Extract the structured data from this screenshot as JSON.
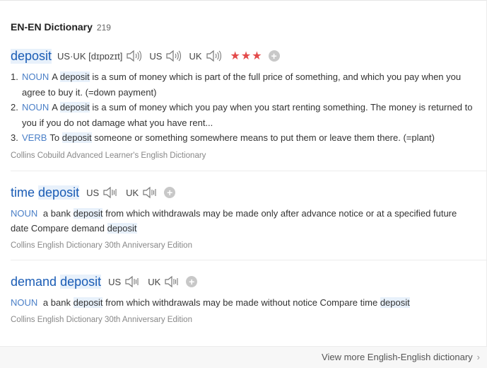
{
  "header": {
    "title": "EN-EN Dictionary",
    "count": "219"
  },
  "entries": [
    {
      "headword": "deposit",
      "pron_label": "US·UK [dɪpɒzɪt]",
      "us_label": "US",
      "uk_label": "UK",
      "stars": "★★★",
      "senses": [
        {
          "num": "1.",
          "pos": "NOUN",
          "pre": "A ",
          "hl": "deposit",
          "post": " is a sum of money which is part of the full price of something, and which you pay when you agree to buy it. (=down payment)"
        },
        {
          "num": "2.",
          "pos": "NOUN",
          "pre": "A ",
          "hl": "deposit",
          "post": " is a sum of money which you pay when you start renting something. The money is returned to you if you do not damage what you have rent..."
        },
        {
          "num": "3.",
          "pos": "VERB",
          "pre": "To ",
          "hl": "deposit",
          "post": " someone or something somewhere means to put them or leave them there. (=plant)"
        }
      ],
      "source": "Collins Cobuild Advanced Learner's English Dictionary"
    },
    {
      "headword_pre": "time",
      "headword_hl": "deposit",
      "us_label": "US",
      "uk_label": "UK",
      "pos": "NOUN",
      "def_a": "a bank ",
      "def_hl1": "deposit",
      "def_b": " from which withdrawals may be made only after advance notice or at a specified future date Compare demand ",
      "def_hl2": "deposit",
      "source": "Collins English Dictionary 30th Anniversary Edition"
    },
    {
      "headword_pre": "demand",
      "headword_hl": "deposit",
      "us_label": "US",
      "uk_label": "UK",
      "pos": "NOUN",
      "def_a": "a bank ",
      "def_hl1": "deposit",
      "def_b": " from which withdrawals may be made without notice Compare time ",
      "def_hl2": "deposit",
      "source": "Collins English Dictionary 30th Anniversary Edition"
    }
  ],
  "footer": {
    "more_label": "View more English-English dictionary",
    "chevron": "›"
  },
  "colors": {
    "headword": "#1a5cb5",
    "pos": "#4a7fc7",
    "stars": "#e34a4a",
    "highlight": "#e8f1fb"
  },
  "icons": {
    "speaker": "speaker-icon",
    "add": "plus-circle-icon",
    "more": "chevron-right-icon"
  }
}
